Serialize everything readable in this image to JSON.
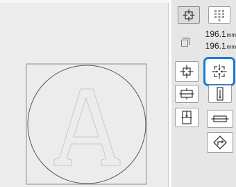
{
  "view_mode": {
    "buttons": [
      {
        "id": "single-pattern",
        "icon": "center-pattern-icon",
        "selected": true
      },
      {
        "id": "grid-pattern",
        "icon": "grid-dots-icon",
        "selected": false
      }
    ]
  },
  "pattern_size": {
    "icon": "pattern-size-icon",
    "width_value": "196.1",
    "width_unit": "mm",
    "height_value": "196.1",
    "height_unit": "mm"
  },
  "arrange_tools": {
    "buttons": [
      {
        "id": "arrow-out-all",
        "icon": "expand-arrows-icon",
        "highlighted": false
      },
      {
        "id": "arrow-in-all",
        "icon": "contract-arrows-icon",
        "highlighted": true
      },
      {
        "id": "arrow-horizontal-out",
        "icon": "horizontal-arrows-icon",
        "highlighted": false
      },
      {
        "id": "arrow-vertical-in",
        "icon": "vertical-arrows-icon",
        "highlighted": false
      },
      {
        "id": "vertical-center",
        "icon": "vertical-center-icon",
        "highlighted": false
      },
      {
        "id": "horizontal-spread",
        "icon": "horizontal-spread-icon",
        "highlighted": false
      },
      {
        "id": "rotate-diamond",
        "icon": "diamond-rotate-icon",
        "highlighted": false
      }
    ]
  },
  "colors": {
    "highlight": "#1e78d6",
    "canvas_bg": "#ececec",
    "panel_bg": "#e6e6e6"
  }
}
